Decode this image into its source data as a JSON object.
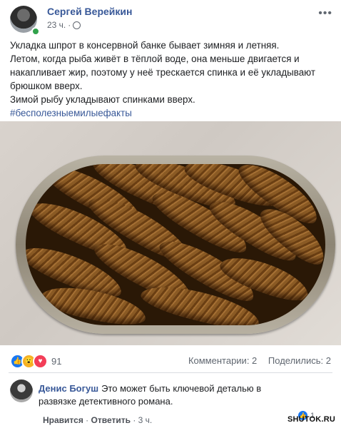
{
  "post": {
    "author": "Сергей Верейкин",
    "time": "23 ч.",
    "more_icon": "more-icon",
    "text_lines": [
      "Укладка шпрот в консервной банке бывает зимняя и летняя.",
      "Летом, когда рыба живёт в тёплой воде, она меньше двигается и накапливает жир, поэтому у неё трескается спинка и её укладывают брюшком вверх.",
      "Зимой рыбу укладывают спинками вверх."
    ],
    "hashtag": "#бесполезныемилыефакты"
  },
  "stats": {
    "reactions_count": "91",
    "comments": "Комментарии: 2",
    "shares": "Поделились: 2"
  },
  "comment": {
    "author": "Денис Богуш",
    "text": "Это может быть ключевой деталью в развязке детективного романа.",
    "like": "Нравится",
    "reply": "Ответить",
    "time": "3 ч.",
    "likes": "1"
  },
  "watermark": "SHUTOK.RU",
  "colors": {
    "link": "#385898",
    "like": "#1877f2",
    "love": "#f33e58",
    "wow": "#f7b125"
  }
}
